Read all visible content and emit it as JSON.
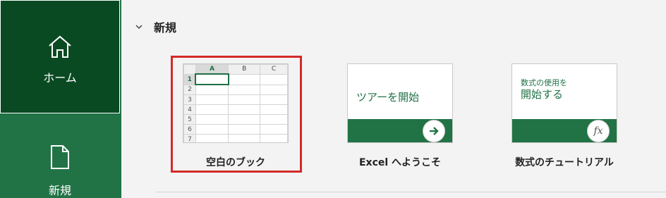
{
  "sidebar": {
    "items": [
      {
        "label": "ホーム",
        "icon": "home-icon",
        "active": true
      },
      {
        "label": "新規",
        "icon": "new-document-icon",
        "active": false
      }
    ]
  },
  "main": {
    "section_title": "新規",
    "templates": [
      {
        "label": "空白のブック",
        "kind": "blank-workbook",
        "selected": true,
        "columns": [
          "A",
          "B",
          "C"
        ],
        "rows": [
          "1",
          "2",
          "3",
          "4",
          "5",
          "6",
          "7"
        ]
      },
      {
        "label": "Excel へようこそ",
        "kind": "tour",
        "thumb_text": "ツアーを開始",
        "icon": "arrow-right-icon"
      },
      {
        "label": "数式のチュートリアル",
        "kind": "formula-tutorial",
        "thumb_small": "数式の使用を",
        "thumb_large": "開始する",
        "icon_glyph": "fx"
      }
    ]
  },
  "colors": {
    "brand": "#217346",
    "brand_dark": "#0a4a23",
    "selection": "#d42a2a"
  }
}
